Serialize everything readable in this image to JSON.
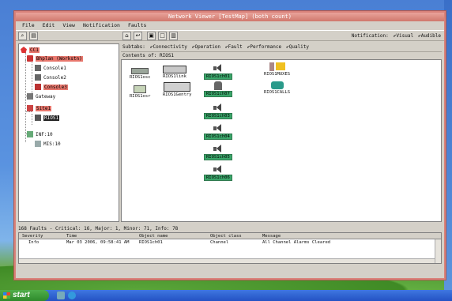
{
  "window": {
    "title": "Network Viewer [TestMap] (both count)"
  },
  "menu": [
    "File",
    "Edit",
    "View",
    "Notification",
    "Faults"
  ],
  "notification": {
    "label": "Notification:",
    "options": [
      "Visual",
      "Audible"
    ]
  },
  "tree": [
    {
      "label": "CC1",
      "style": "red",
      "icon": "cluster-icon"
    },
    {
      "label": "Bhplan (Workstn)",
      "style": "red",
      "icon": "server-icon"
    },
    {
      "label": "Console1",
      "style": "none",
      "icon": "console-icon"
    },
    {
      "label": "Console2",
      "style": "none",
      "icon": "console-icon"
    },
    {
      "label": "Console3",
      "style": "red",
      "icon": "console-icon"
    },
    {
      "label": "Gateway",
      "style": "none",
      "icon": "gateway-icon"
    },
    {
      "label": "Site1",
      "style": "red",
      "icon": "site-icon"
    },
    {
      "label": "RIOS1",
      "style": "dark",
      "icon": "rios-icon"
    },
    {
      "label": "INF:10",
      "style": "none",
      "icon": "network-icon"
    },
    {
      "label": "MIS:10",
      "style": "none",
      "icon": "network-icon"
    }
  ],
  "subtabs": {
    "label": "Subtabs:",
    "items": [
      "Connectivity",
      "Operation",
      "Fault",
      "Performance",
      "Quality"
    ]
  },
  "contents": {
    "label": "Contents of:",
    "value": "RIOS1"
  },
  "nodes": {
    "r1": "RIOS1osc",
    "r2": "RIOS1link",
    "r3": "RIOS1ch01",
    "r4": "RIOS1MUXES",
    "r5": "RIOS1osr",
    "r6": "RIOS1Gentry",
    "r7": "RIOS1ch07",
    "r8": "RIOS1CALLS",
    "ch03": "RIOS1ch03",
    "ch04": "RIOS1ch04",
    "ch05": "RIOS1ch05",
    "ch06": "RIOS1ch06"
  },
  "faults": {
    "summary": "168 Faults - Critical: 16, Major: 1, Minor: 71, Info: 78",
    "columns": [
      "Severity",
      "Time",
      "Object name",
      "Object class",
      "Message"
    ],
    "rows": [
      {
        "severity": "Info",
        "time": "Mar 03 2006, 09:58:41 AM",
        "name": "RIOS1ch01",
        "class": "Channel",
        "message": "All Channel Alarms Cleared"
      }
    ]
  },
  "taskbar": {
    "start": "start"
  },
  "colors": {
    "titlebar": "#d0786d",
    "highlight_red": "#e8776d",
    "node_label_green": "#3aa66a"
  }
}
